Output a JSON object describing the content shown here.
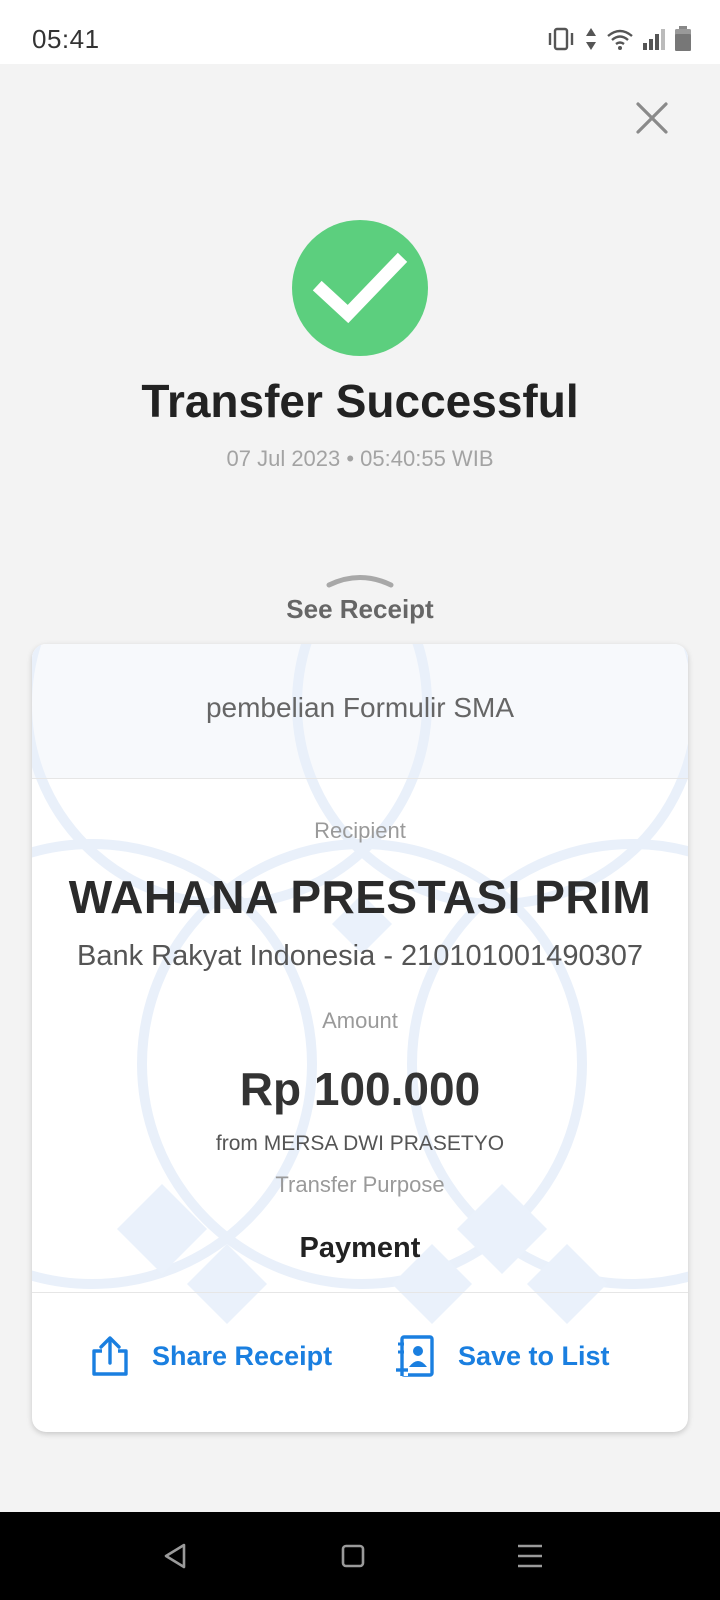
{
  "status_bar": {
    "time": "05:41"
  },
  "header": {
    "close_icon": "close-icon"
  },
  "result": {
    "icon": "check-circle-icon",
    "title": "Transfer Successful",
    "datetime": "07 Jul 2023 • 05:40:55 WIB"
  },
  "see_receipt": {
    "label": "See Receipt"
  },
  "receipt": {
    "note": "pembelian Formulir SMA",
    "recipient_label": "Recipient",
    "recipient_name": "WAHANA PRESTASI PRIM",
    "recipient_bank": "Bank Rakyat Indonesia - 210101001490307",
    "amount_label": "Amount",
    "amount": "Rp 100.000",
    "from": "from MERSA DWI PRASETYO",
    "purpose_label": "Transfer Purpose",
    "purpose": "Payment"
  },
  "actions": {
    "share_label": "Share Receipt",
    "save_label": "Save to List"
  },
  "colors": {
    "success": "#5ccf7e",
    "accent": "#1a7fe0",
    "background": "#f3f3f3"
  }
}
